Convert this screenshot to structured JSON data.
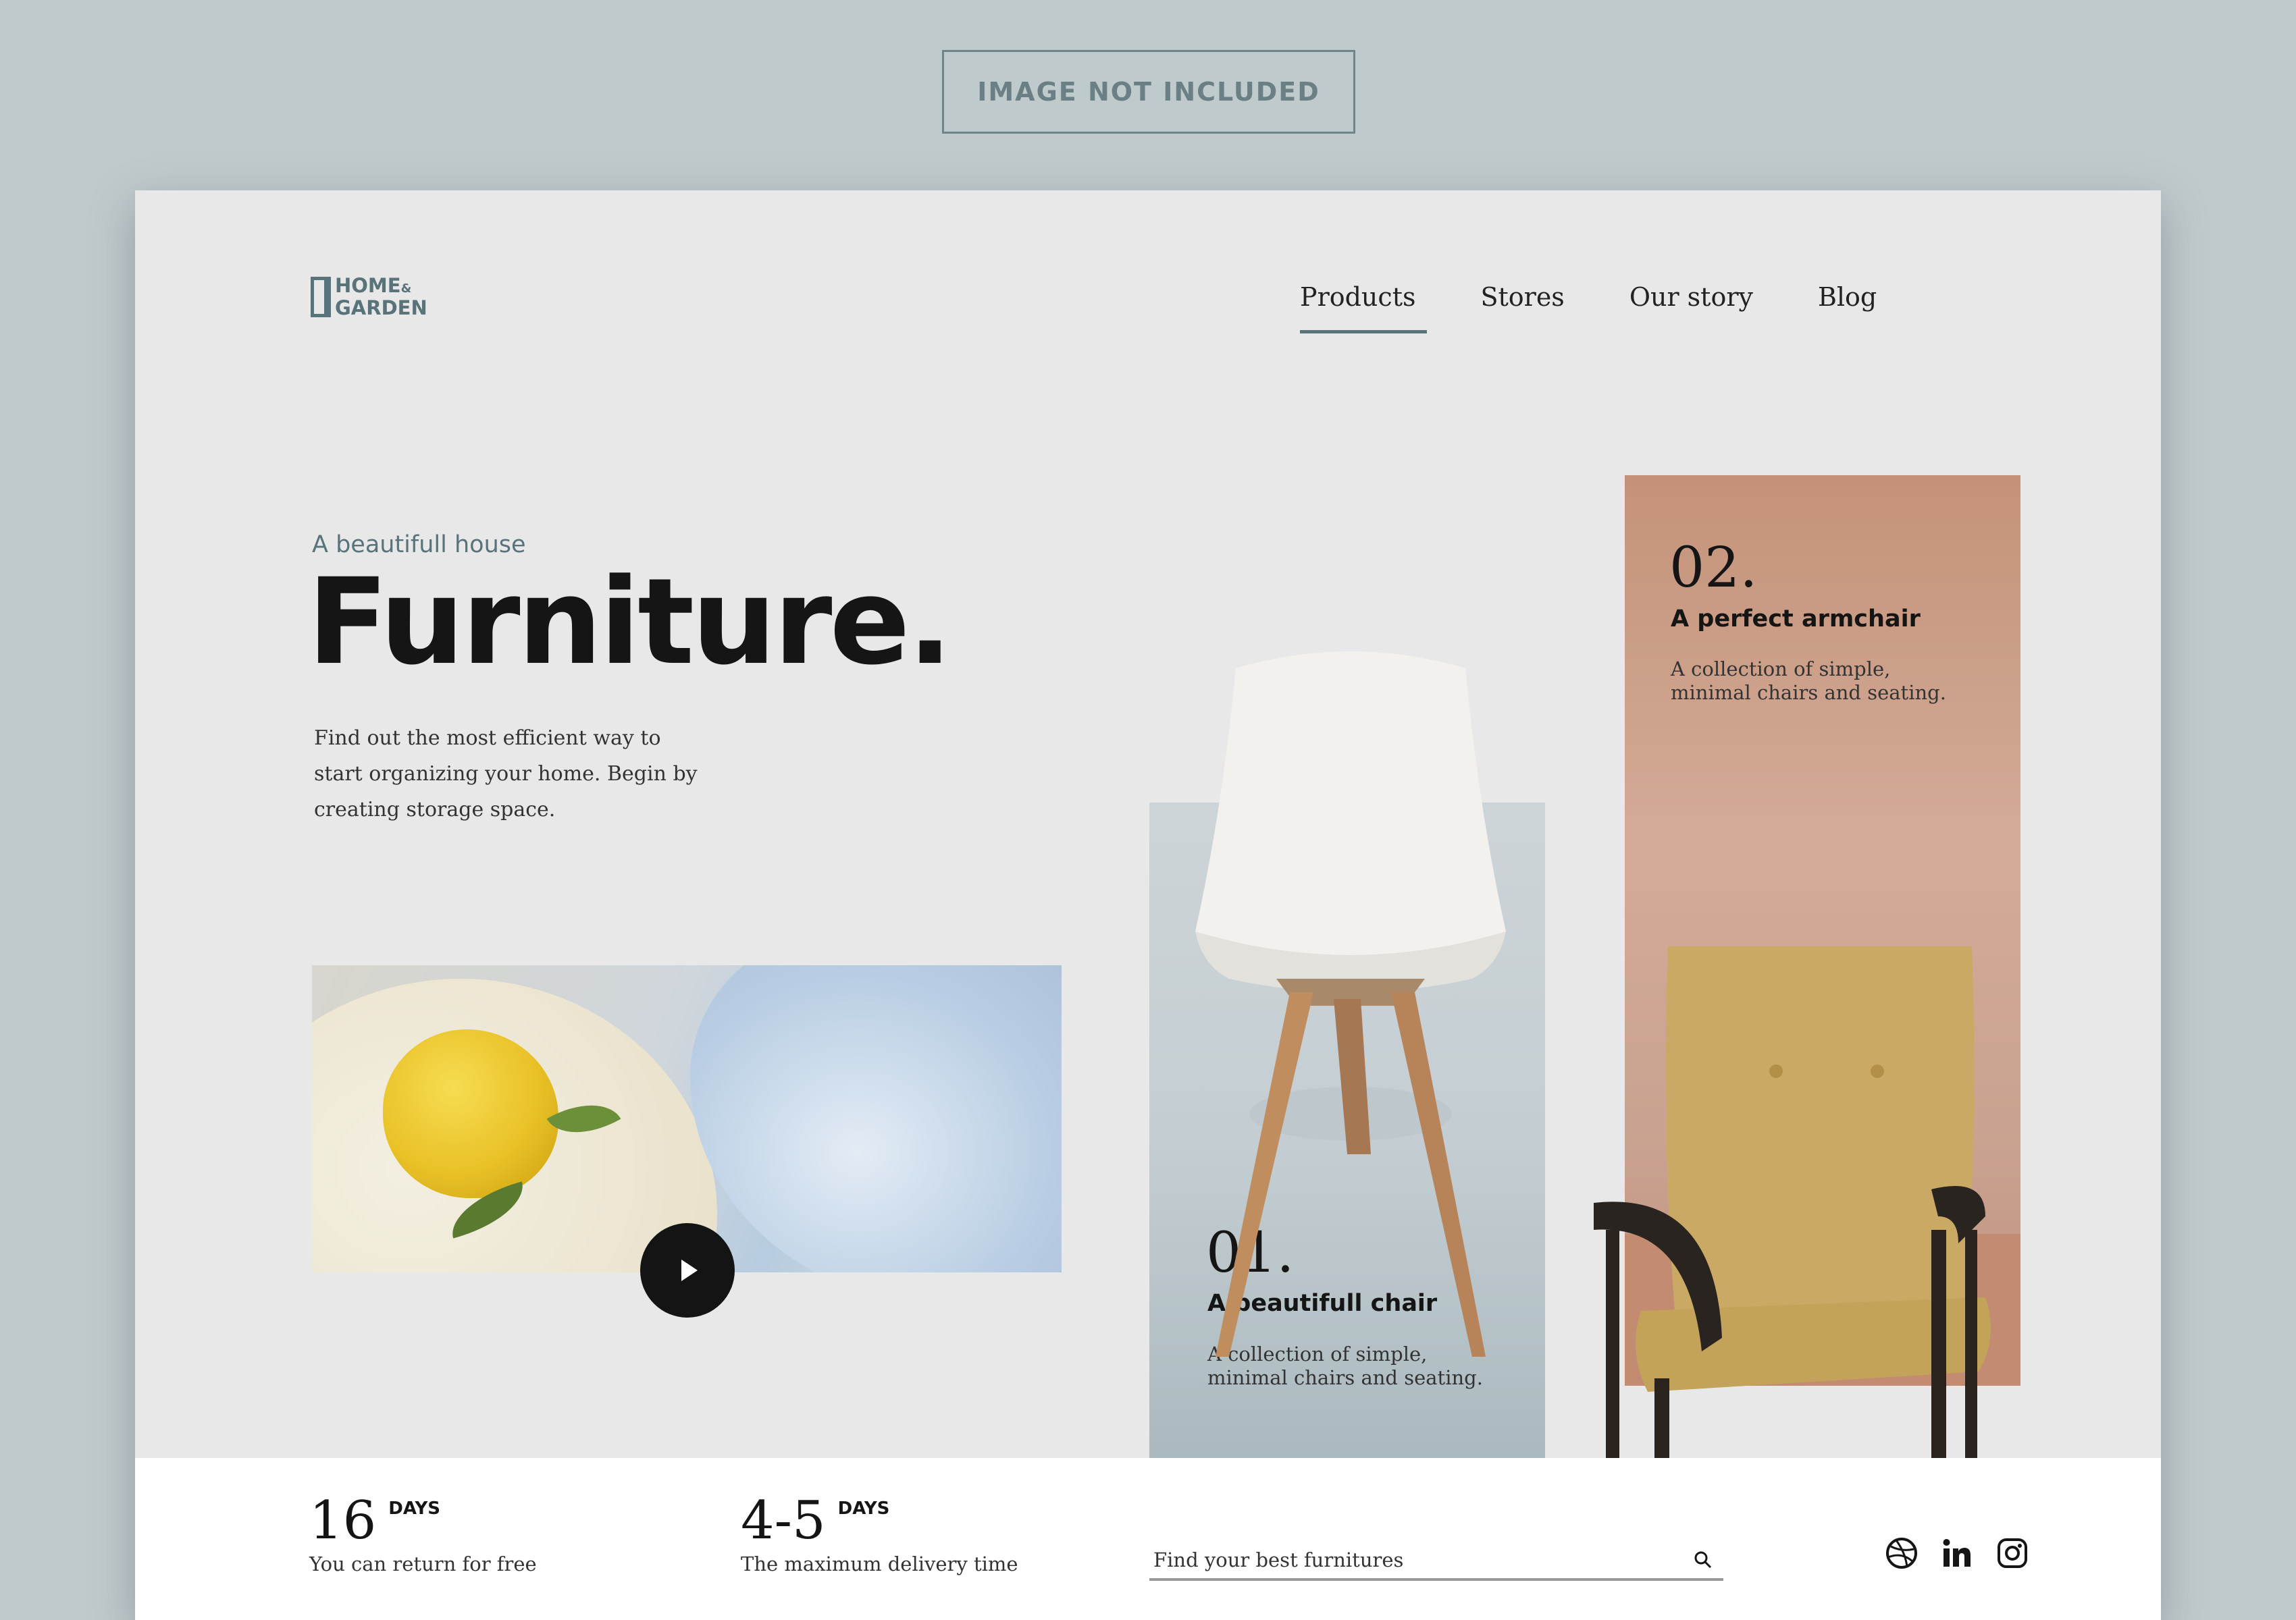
{
  "notice": "IMAGE NOT INCLUDED",
  "brand": {
    "line1": "HOME",
    "amp": "&",
    "line2": "GARDEN"
  },
  "nav": {
    "items": [
      {
        "label": "Products",
        "active": true
      },
      {
        "label": "Stores",
        "active": false
      },
      {
        "label": "Our story",
        "active": false
      },
      {
        "label": "Blog",
        "active": false
      }
    ]
  },
  "hero": {
    "eyebrow": "A beautifull house",
    "title": "Furniture.",
    "intro": "Find out the most efficient way to start organizing your home. Begin by creating storage space."
  },
  "video": {
    "play_icon": "play-icon"
  },
  "cards": [
    {
      "number": "01.",
      "title": "A beautifull chair",
      "description": "A collection of simple, minimal chairs and seating."
    },
    {
      "number": "02.",
      "title": "A perfect armchair",
      "description": "A collection of simple, minimal chairs and seating."
    }
  ],
  "stats": [
    {
      "value": "16",
      "unit": "DAYS",
      "label": "You can return for free"
    },
    {
      "value": "4-5",
      "unit": "DAYS",
      "label": "The maximum delivery time"
    }
  ],
  "search": {
    "placeholder": "Find your best furnitures",
    "icon": "search-icon"
  },
  "social": [
    "dribbble-icon",
    "linkedin-icon",
    "instagram-icon"
  ],
  "colors": {
    "accent": "#587379",
    "card_blue": "#c4ced2",
    "card_terracotta": "#c49279",
    "dark": "#151515"
  }
}
